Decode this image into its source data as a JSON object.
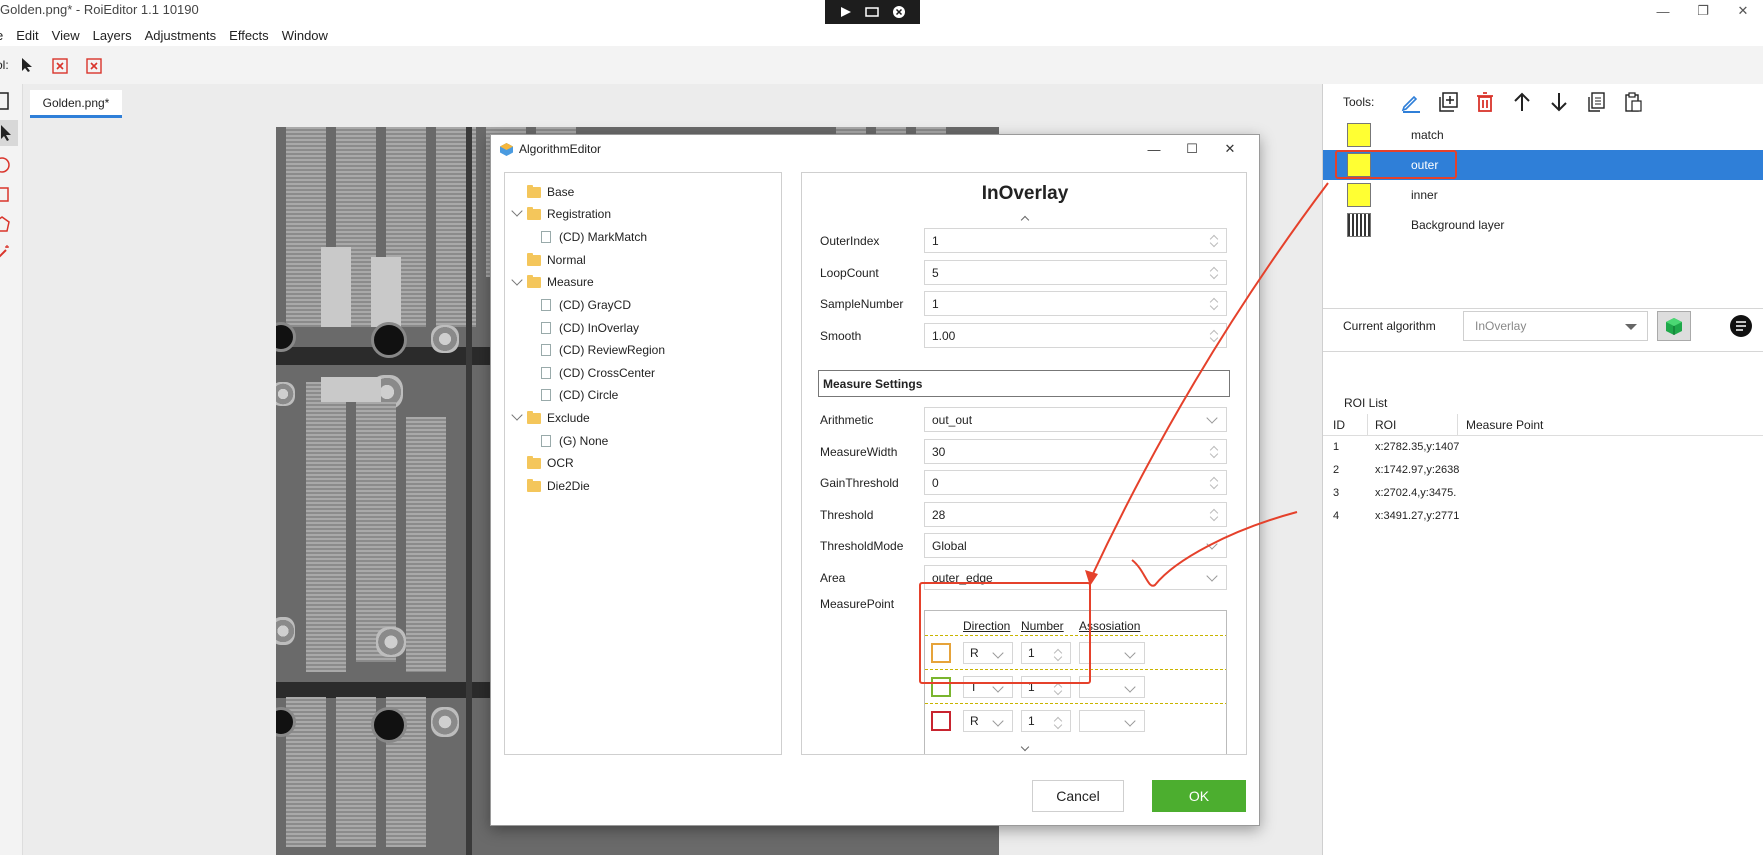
{
  "app": {
    "title": "Golden.png* - RoiEditor 1.1 10190"
  },
  "window_controls": {
    "minimize": "—",
    "restore": "❐",
    "close": "✕"
  },
  "menu": [
    "e",
    "Edit",
    "View",
    "Layers",
    "Adjustments",
    "Effects",
    "Window"
  ],
  "toolbar": {
    "label": "ol:"
  },
  "document": {
    "tab": "Golden.png*"
  },
  "colors": {
    "accent": "#2f7fd8",
    "ok_green": "#4cae2f",
    "annotation_red": "#e5412b",
    "layer_yellow": "#ffff33"
  },
  "right_panel": {
    "tools_label": "Tools:",
    "tool_icons": [
      "pencil-icon",
      "add-layer-icon",
      "trash-icon",
      "arrow-up-icon",
      "arrow-down-icon",
      "copy-icon",
      "paste-icon"
    ],
    "layers": [
      {
        "name": "match",
        "selected": false
      },
      {
        "name": "outer",
        "selected": true
      },
      {
        "name": "inner",
        "selected": false
      },
      {
        "name": "Background layer",
        "selected": false
      }
    ],
    "current_algorithm_label": "Current algorithm",
    "current_algorithm_value": "InOverlay",
    "roi_list_title": "ROI List",
    "roi_columns": [
      "ID",
      "ROI",
      "Measure Point"
    ],
    "roi_rows": [
      {
        "id": "1",
        "roi": "x:2782.35,y:1407",
        "mp": ""
      },
      {
        "id": "2",
        "roi": "x:1742.97,y:2638",
        "mp": ""
      },
      {
        "id": "3",
        "roi": "x:2702.4,y:3475.",
        "mp": ""
      },
      {
        "id": "4",
        "roi": "x:3491.27,y:2771",
        "mp": ""
      }
    ]
  },
  "dialog": {
    "title": "AlgorithmEditor",
    "controls": {
      "minimize": "—",
      "maximize": "☐",
      "close": "✕"
    },
    "tree": [
      {
        "label": "Base",
        "kind": "folder"
      },
      {
        "label": "Registration",
        "kind": "folder"
      },
      {
        "label": "(CD) MarkMatch",
        "kind": "file"
      },
      {
        "label": "Normal",
        "kind": "folder"
      },
      {
        "label": "Measure",
        "kind": "folder"
      },
      {
        "label": "(CD) GrayCD",
        "kind": "file"
      },
      {
        "label": "(CD) InOverlay",
        "kind": "file"
      },
      {
        "label": "(CD) ReviewRegion",
        "kind": "file"
      },
      {
        "label": "(CD) CrossCenter",
        "kind": "file"
      },
      {
        "label": "(CD) Circle",
        "kind": "file"
      },
      {
        "label": "Exclude",
        "kind": "folder"
      },
      {
        "label": "(G) None",
        "kind": "file"
      },
      {
        "label": "OCR",
        "kind": "folder"
      },
      {
        "label": "Die2Die",
        "kind": "folder"
      }
    ],
    "props_title": "InOverlay",
    "fields": [
      {
        "label": "OuterIndex",
        "value": "1",
        "kind": "spin"
      },
      {
        "label": "LoopCount",
        "value": "5",
        "kind": "spin"
      },
      {
        "label": "SampleNumber",
        "value": "1",
        "kind": "spin"
      },
      {
        "label": "Smooth",
        "value": "1.00",
        "kind": "spin"
      }
    ],
    "section": "Measure Settings",
    "settings": [
      {
        "label": "Arithmetic",
        "value": "out_out",
        "kind": "dropdown"
      },
      {
        "label": "MeasureWidth",
        "value": "30",
        "kind": "spin"
      },
      {
        "label": "GainThreshold",
        "value": "0",
        "kind": "spin"
      },
      {
        "label": "Threshold",
        "value": "28",
        "kind": "spin"
      },
      {
        "label": "ThresholdMode",
        "value": "Global",
        "kind": "dropdown"
      },
      {
        "label": "Area",
        "value": "outer_edge",
        "kind": "dropdown"
      }
    ],
    "measure_point_label": "MeasurePoint",
    "mp_columns": [
      "Direction",
      "Number",
      "Assosiation"
    ],
    "mp_rows": [
      {
        "color": "#e6a33a",
        "direction": "R",
        "number": "1"
      },
      {
        "color": "#7ab52e",
        "direction": "T",
        "number": "1"
      },
      {
        "color": "#c8242f",
        "direction": "R",
        "number": "1"
      }
    ],
    "cancel": "Cancel",
    "ok": "OK"
  }
}
